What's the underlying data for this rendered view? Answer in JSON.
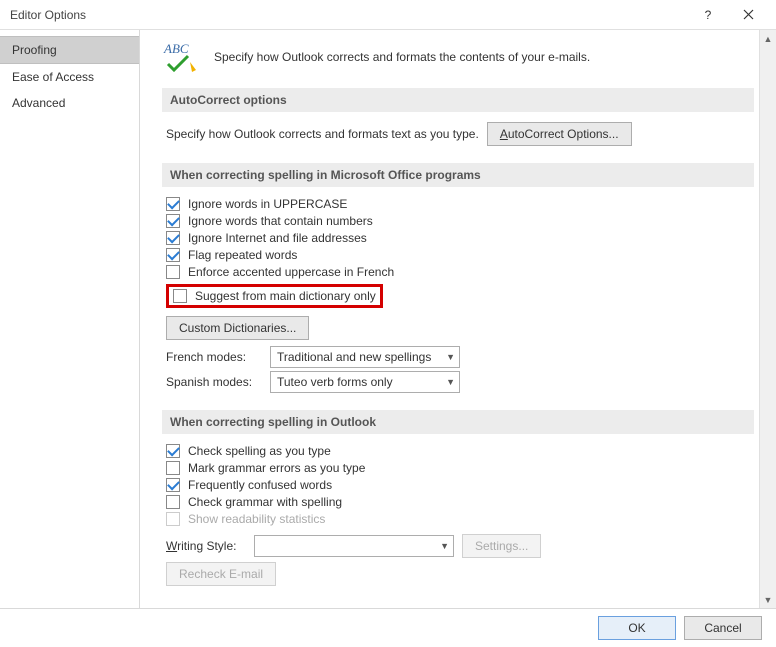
{
  "title": "Editor Options",
  "sidebar": {
    "items": [
      {
        "label": "Proofing",
        "selected": true
      },
      {
        "label": "Ease of Access",
        "selected": false
      },
      {
        "label": "Advanced",
        "selected": false
      }
    ]
  },
  "intro": "Specify how Outlook corrects and formats the contents of your e-mails.",
  "autocorrect": {
    "header": "AutoCorrect options",
    "desc": "Specify how Outlook corrects and formats text as you type.",
    "button": "AutoCorrect Options..."
  },
  "spelling_office": {
    "header": "When correcting spelling in Microsoft Office programs",
    "opts": [
      {
        "label": "Ignore words in UPPERCASE",
        "checked": true
      },
      {
        "label": "Ignore words that contain numbers",
        "checked": true
      },
      {
        "label": "Ignore Internet and file addresses",
        "checked": true
      },
      {
        "label": "Flag repeated words",
        "checked": true
      },
      {
        "label": "Enforce accented uppercase in French",
        "checked": false
      },
      {
        "label": "Suggest from main dictionary only",
        "checked": false,
        "highlight": true
      }
    ],
    "custom_dict_btn": "Custom Dictionaries...",
    "french_label": "French modes:",
    "french_value": "Traditional and new spellings",
    "spanish_label": "Spanish modes:",
    "spanish_value": "Tuteo verb forms only"
  },
  "spelling_outlook": {
    "header": "When correcting spelling in Outlook",
    "opts": [
      {
        "label": "Check spelling as you type",
        "checked": true
      },
      {
        "label": "Mark grammar errors as you type",
        "checked": false
      },
      {
        "label": "Frequently confused words",
        "checked": true
      },
      {
        "label": "Check grammar with spelling",
        "checked": false
      },
      {
        "label": "Show readability statistics",
        "checked": false,
        "disabled": true
      }
    ],
    "writing_style_label": "Writing Style:",
    "writing_style_value": "",
    "settings_btn": "Settings...",
    "recheck_btn": "Recheck E-mail"
  },
  "footer": {
    "ok": "OK",
    "cancel": "Cancel"
  }
}
